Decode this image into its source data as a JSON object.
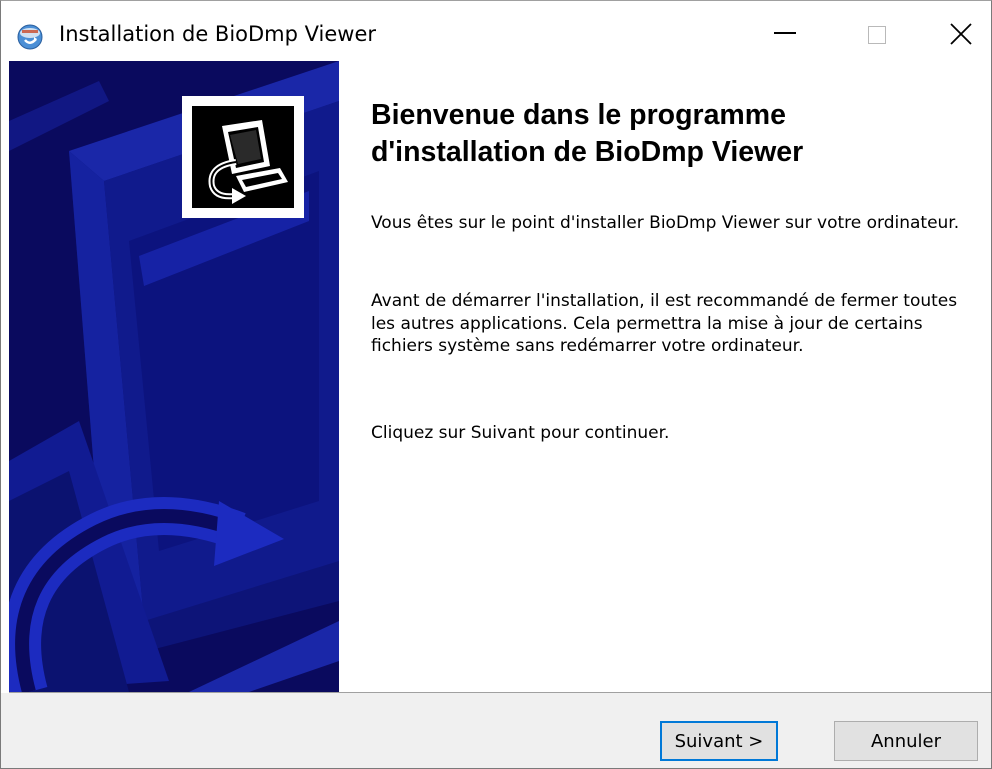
{
  "window": {
    "title": "Installation de BioDmp Viewer",
    "icon": "installer-globe-icon",
    "controls": {
      "minimize": "minimize-icon",
      "maximize": "maximize-icon",
      "close_glyph": "✕"
    }
  },
  "banner": {
    "background_color": "#0a0a5e",
    "accent_color": "#1f2fc0",
    "badge_icon": "setup-computer-icon"
  },
  "content": {
    "heading_line1": "Bienvenue dans le programme",
    "heading_line2": "d'installation de BioDmp Viewer",
    "paragraph1": "Vous êtes sur le point d'installer BioDmp Viewer sur votre ordinateur.",
    "paragraph2": "Avant de démarrer l'installation, il est recommandé de fermer toutes les autres applications. Cela permettra la mise à jour de certains fichiers système sans redémarrer votre ordinateur.",
    "paragraph3": "Cliquez sur Suivant pour continuer."
  },
  "footer": {
    "next_label": "Suivant >",
    "cancel_label": "Annuler",
    "focus_color": "#0078d7"
  }
}
